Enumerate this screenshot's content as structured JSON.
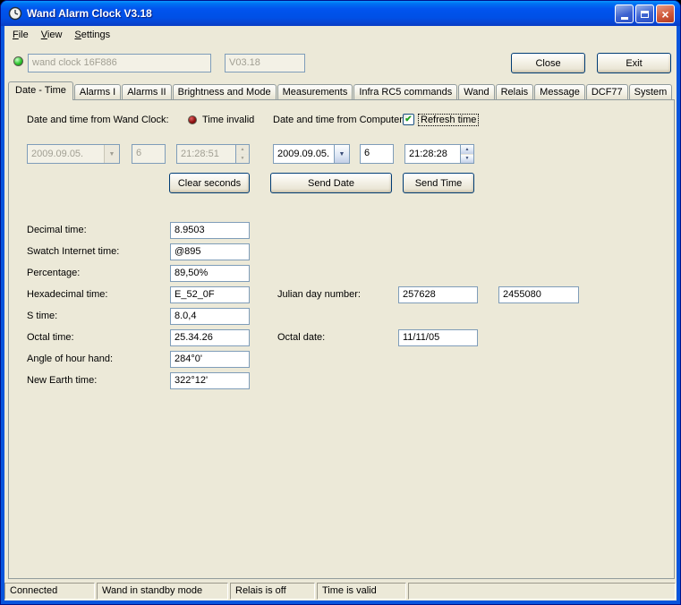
{
  "window": {
    "title": "Wand Alarm Clock V3.18"
  },
  "icons": {
    "app_icon": "clock",
    "close_glyph": "×",
    "dropdown_arrow": "▼",
    "spin_up": "▲",
    "spin_down": "▼",
    "check_glyph": "✔"
  },
  "colors": {
    "connected_led": "#2DC52D",
    "time_invalid_led": "#8E1212",
    "titlebar_blue": "#0154EE",
    "client_background": "#ECE9D8"
  },
  "menu": {
    "items": [
      "File",
      "View",
      "Settings"
    ]
  },
  "header": {
    "device_name": "wand clock 16F886",
    "version": "V03.18",
    "close_button": "Close",
    "exit_button": "Exit"
  },
  "tabs": [
    "Date - Time",
    "Alarms I",
    "Alarms II",
    "Brightness and Mode",
    "Measurements",
    "Infra RC5 commands",
    "Wand",
    "Relais",
    "Message",
    "DCF77",
    "System"
  ],
  "wand_time": {
    "label": "Date and time from Wand Clock:",
    "status": "Time invalid",
    "date": "2009.09.05.",
    "day_of_week": "6",
    "time": "21:28:51",
    "clear_seconds_button": "Clear seconds"
  },
  "computer_time": {
    "label": "Date and time from Computer:",
    "refresh_checkbox_label": "Refresh time",
    "refresh_checked": true,
    "date": "2009.09.05.",
    "day_of_week": "6",
    "time": "21:28:28",
    "send_date_button": "Send Date",
    "send_time_button": "Send Time"
  },
  "fields": [
    {
      "label": "Decimal time:",
      "value": "8.9503"
    },
    {
      "label": "Swatch Internet time:",
      "value": "@895"
    },
    {
      "label": "Percentage:",
      "value": "89,50%"
    },
    {
      "label": "Hexadecimal time:",
      "value": "E_52_0F"
    },
    {
      "label": "S time:",
      "value": "8.0,4"
    },
    {
      "label": "Octal time:",
      "value": "25.34.26"
    },
    {
      "label": "Angle of hour hand:",
      "value": "284°0'"
    },
    {
      "label": "New Earth time:",
      "value": "322°12'"
    }
  ],
  "julian": {
    "label": "Julian day number:",
    "value_1": "257628",
    "value_2": "2455080"
  },
  "octal_date": {
    "label": "Octal date:",
    "value": "11/11/05"
  },
  "statusbar": {
    "panels": [
      "Connected",
      "Wand in standby mode",
      "Relais is off",
      "Time is valid",
      ""
    ]
  }
}
